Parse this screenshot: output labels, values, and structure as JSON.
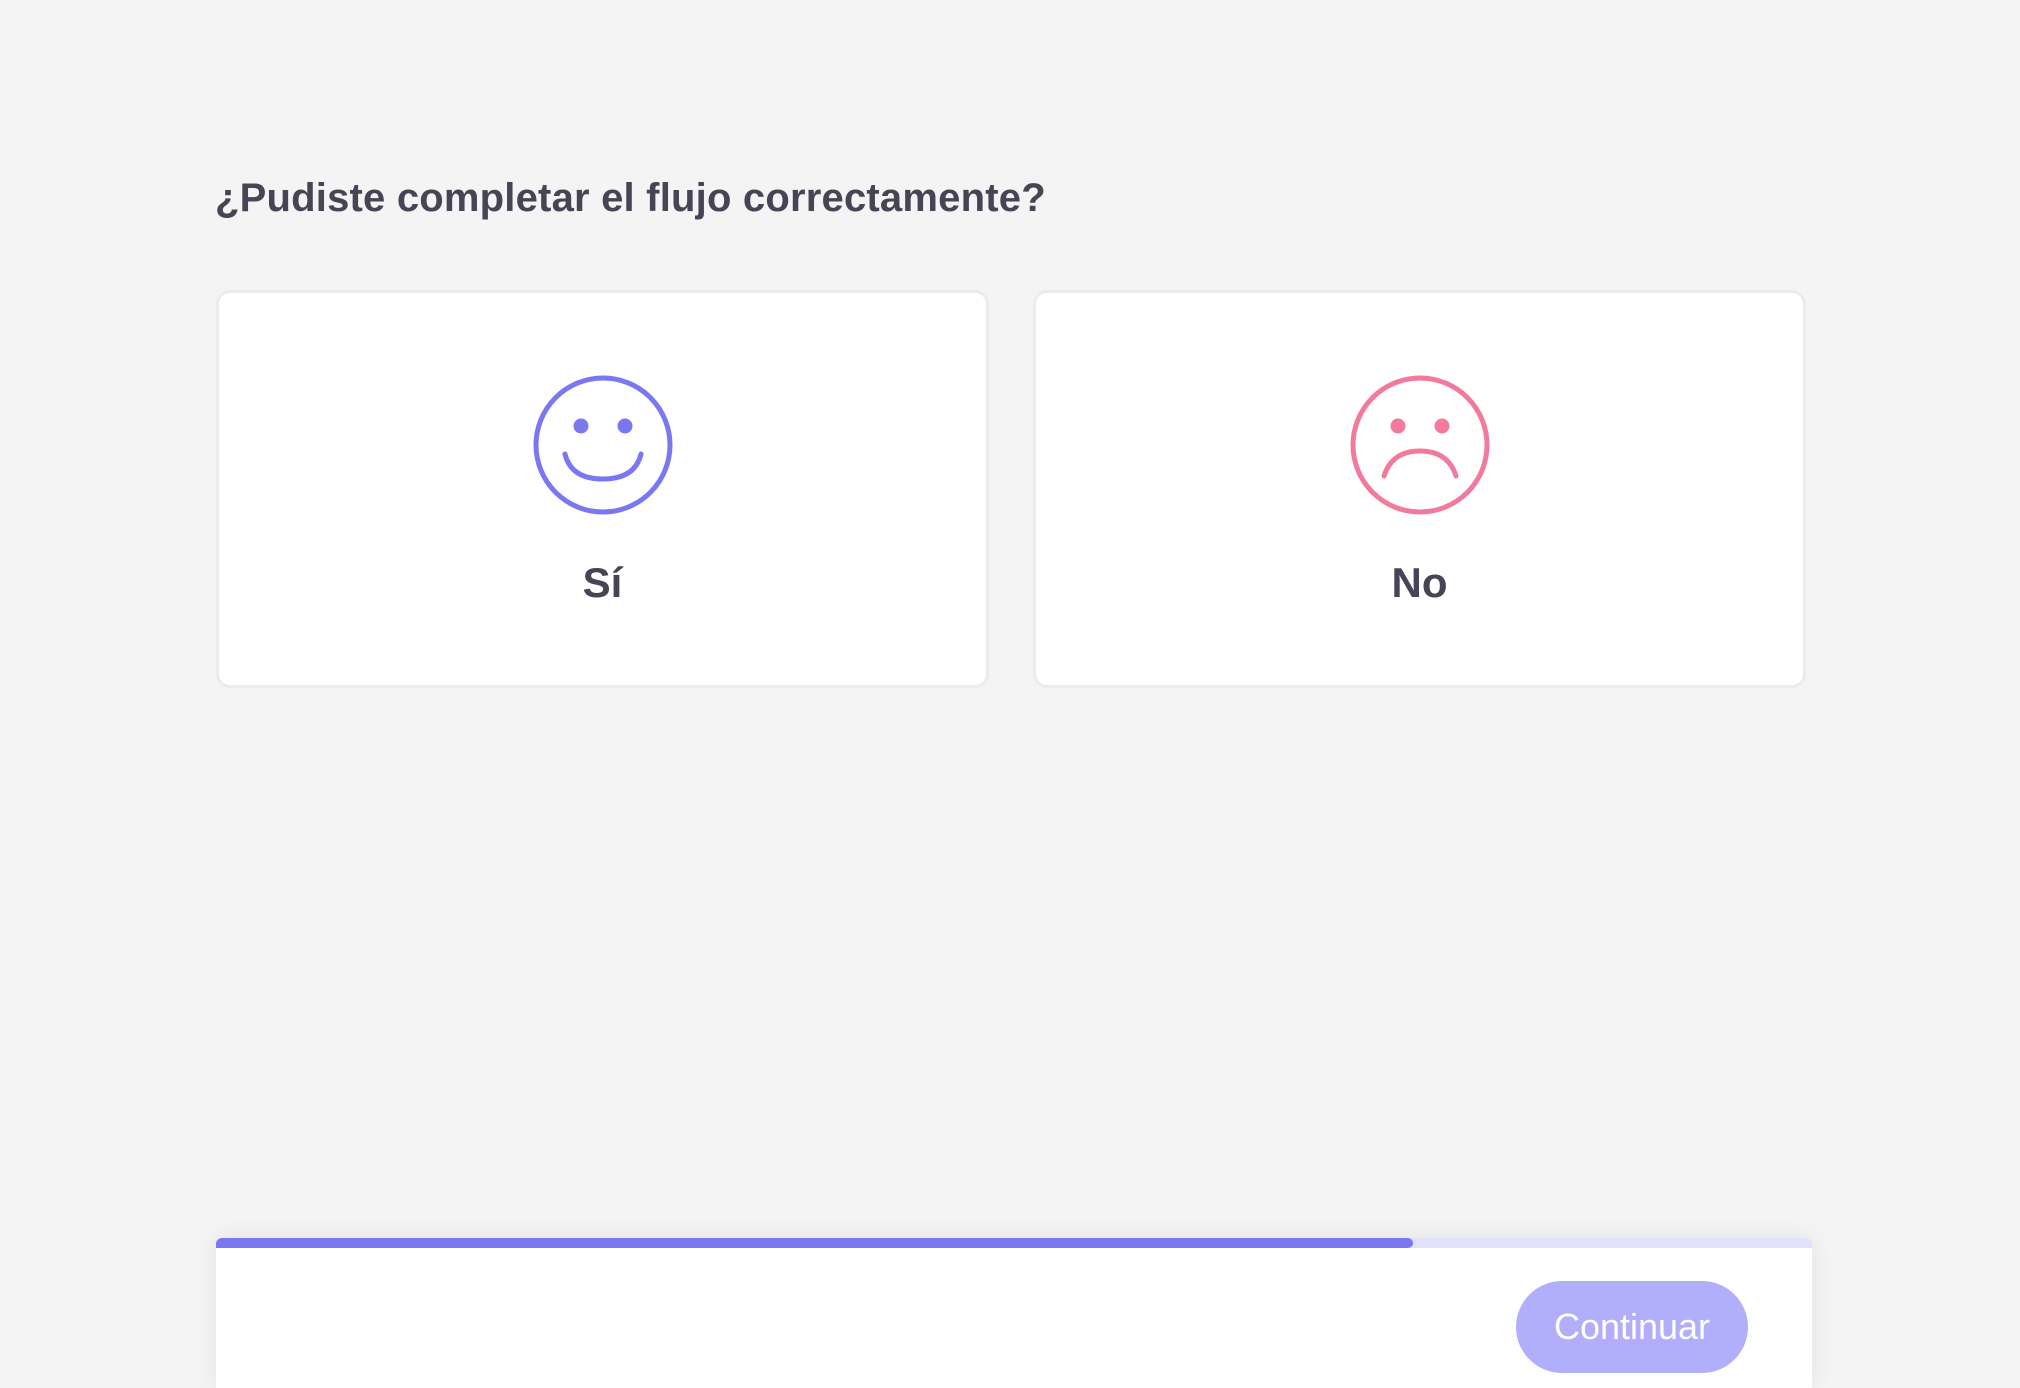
{
  "question": "¿Pudiste completar el flujo correctamente?",
  "options": [
    {
      "label": "Sí",
      "icon": "smiley-face-icon",
      "color": "#7b76f2"
    },
    {
      "label": "No",
      "icon": "sad-face-icon",
      "color": "#f27a9c"
    }
  ],
  "progress": {
    "value": 0.75,
    "fill_color": "#7b76f2",
    "track_color": "#e2e1fb"
  },
  "footer": {
    "continue_label": "Continuar",
    "button_color": "#b1aefb"
  }
}
